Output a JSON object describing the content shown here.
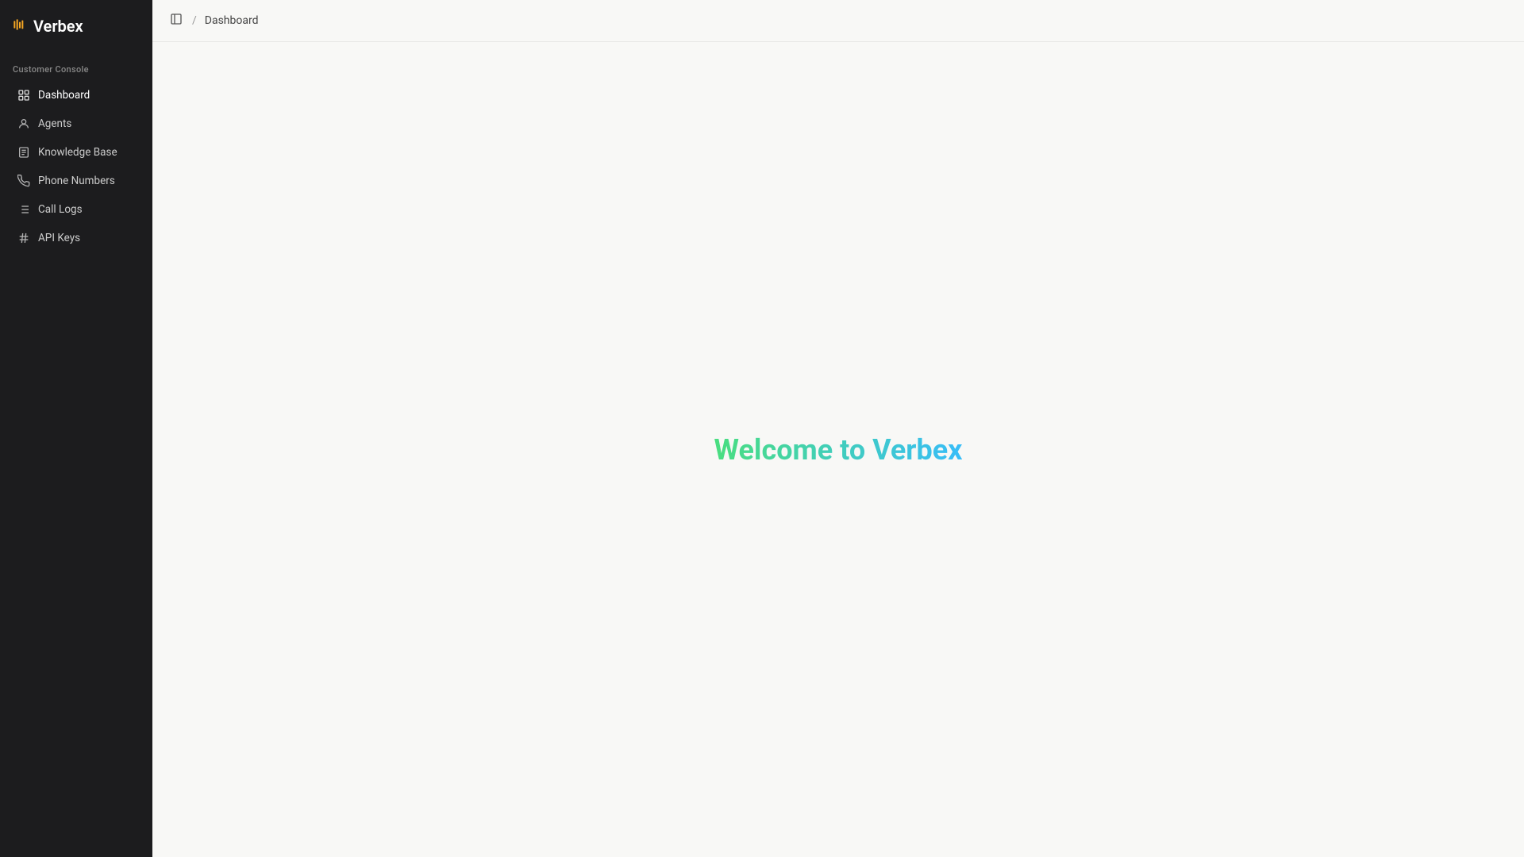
{
  "app": {
    "name": "Verbex"
  },
  "sidebar": {
    "section_label": "Customer Console",
    "nav_items": [
      {
        "id": "dashboard",
        "label": "Dashboard",
        "active": true
      },
      {
        "id": "agents",
        "label": "Agents",
        "active": false
      },
      {
        "id": "knowledge-base",
        "label": "Knowledge Base",
        "active": false
      },
      {
        "id": "phone-numbers",
        "label": "Phone Numbers",
        "active": false
      },
      {
        "id": "call-logs",
        "label": "Call Logs",
        "active": false
      },
      {
        "id": "api-keys",
        "label": "API Keys",
        "active": false
      }
    ]
  },
  "header": {
    "toggle_label": "Toggle sidebar",
    "breadcrumb": "Dashboard"
  },
  "main": {
    "welcome_text": "Welcome to Verbex"
  }
}
